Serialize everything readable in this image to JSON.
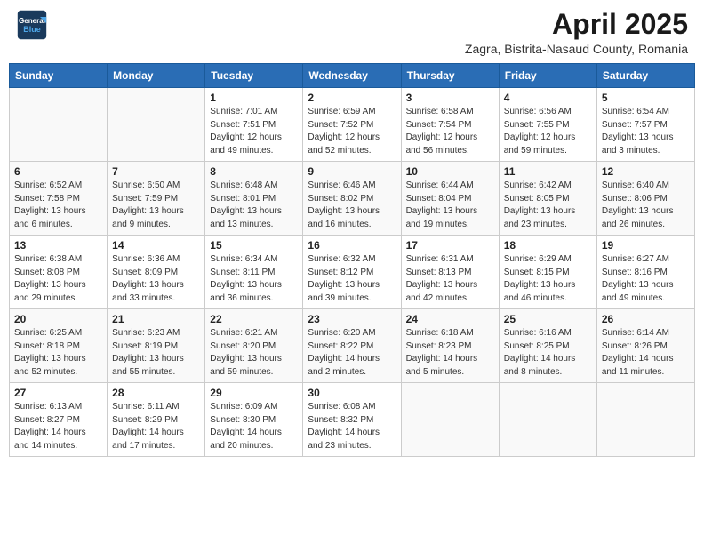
{
  "header": {
    "logo_line1": "General",
    "logo_line2": "Blue",
    "month_title": "April 2025",
    "subtitle": "Zagra, Bistrita-Nasaud County, Romania"
  },
  "columns": [
    "Sunday",
    "Monday",
    "Tuesday",
    "Wednesday",
    "Thursday",
    "Friday",
    "Saturday"
  ],
  "weeks": [
    [
      {
        "day": "",
        "info": ""
      },
      {
        "day": "",
        "info": ""
      },
      {
        "day": "1",
        "info": "Sunrise: 7:01 AM\nSunset: 7:51 PM\nDaylight: 12 hours\nand 49 minutes."
      },
      {
        "day": "2",
        "info": "Sunrise: 6:59 AM\nSunset: 7:52 PM\nDaylight: 12 hours\nand 52 minutes."
      },
      {
        "day": "3",
        "info": "Sunrise: 6:58 AM\nSunset: 7:54 PM\nDaylight: 12 hours\nand 56 minutes."
      },
      {
        "day": "4",
        "info": "Sunrise: 6:56 AM\nSunset: 7:55 PM\nDaylight: 12 hours\nand 59 minutes."
      },
      {
        "day": "5",
        "info": "Sunrise: 6:54 AM\nSunset: 7:57 PM\nDaylight: 13 hours\nand 3 minutes."
      }
    ],
    [
      {
        "day": "6",
        "info": "Sunrise: 6:52 AM\nSunset: 7:58 PM\nDaylight: 13 hours\nand 6 minutes."
      },
      {
        "day": "7",
        "info": "Sunrise: 6:50 AM\nSunset: 7:59 PM\nDaylight: 13 hours\nand 9 minutes."
      },
      {
        "day": "8",
        "info": "Sunrise: 6:48 AM\nSunset: 8:01 PM\nDaylight: 13 hours\nand 13 minutes."
      },
      {
        "day": "9",
        "info": "Sunrise: 6:46 AM\nSunset: 8:02 PM\nDaylight: 13 hours\nand 16 minutes."
      },
      {
        "day": "10",
        "info": "Sunrise: 6:44 AM\nSunset: 8:04 PM\nDaylight: 13 hours\nand 19 minutes."
      },
      {
        "day": "11",
        "info": "Sunrise: 6:42 AM\nSunset: 8:05 PM\nDaylight: 13 hours\nand 23 minutes."
      },
      {
        "day": "12",
        "info": "Sunrise: 6:40 AM\nSunset: 8:06 PM\nDaylight: 13 hours\nand 26 minutes."
      }
    ],
    [
      {
        "day": "13",
        "info": "Sunrise: 6:38 AM\nSunset: 8:08 PM\nDaylight: 13 hours\nand 29 minutes."
      },
      {
        "day": "14",
        "info": "Sunrise: 6:36 AM\nSunset: 8:09 PM\nDaylight: 13 hours\nand 33 minutes."
      },
      {
        "day": "15",
        "info": "Sunrise: 6:34 AM\nSunset: 8:11 PM\nDaylight: 13 hours\nand 36 minutes."
      },
      {
        "day": "16",
        "info": "Sunrise: 6:32 AM\nSunset: 8:12 PM\nDaylight: 13 hours\nand 39 minutes."
      },
      {
        "day": "17",
        "info": "Sunrise: 6:31 AM\nSunset: 8:13 PM\nDaylight: 13 hours\nand 42 minutes."
      },
      {
        "day": "18",
        "info": "Sunrise: 6:29 AM\nSunset: 8:15 PM\nDaylight: 13 hours\nand 46 minutes."
      },
      {
        "day": "19",
        "info": "Sunrise: 6:27 AM\nSunset: 8:16 PM\nDaylight: 13 hours\nand 49 minutes."
      }
    ],
    [
      {
        "day": "20",
        "info": "Sunrise: 6:25 AM\nSunset: 8:18 PM\nDaylight: 13 hours\nand 52 minutes."
      },
      {
        "day": "21",
        "info": "Sunrise: 6:23 AM\nSunset: 8:19 PM\nDaylight: 13 hours\nand 55 minutes."
      },
      {
        "day": "22",
        "info": "Sunrise: 6:21 AM\nSunset: 8:20 PM\nDaylight: 13 hours\nand 59 minutes."
      },
      {
        "day": "23",
        "info": "Sunrise: 6:20 AM\nSunset: 8:22 PM\nDaylight: 14 hours\nand 2 minutes."
      },
      {
        "day": "24",
        "info": "Sunrise: 6:18 AM\nSunset: 8:23 PM\nDaylight: 14 hours\nand 5 minutes."
      },
      {
        "day": "25",
        "info": "Sunrise: 6:16 AM\nSunset: 8:25 PM\nDaylight: 14 hours\nand 8 minutes."
      },
      {
        "day": "26",
        "info": "Sunrise: 6:14 AM\nSunset: 8:26 PM\nDaylight: 14 hours\nand 11 minutes."
      }
    ],
    [
      {
        "day": "27",
        "info": "Sunrise: 6:13 AM\nSunset: 8:27 PM\nDaylight: 14 hours\nand 14 minutes."
      },
      {
        "day": "28",
        "info": "Sunrise: 6:11 AM\nSunset: 8:29 PM\nDaylight: 14 hours\nand 17 minutes."
      },
      {
        "day": "29",
        "info": "Sunrise: 6:09 AM\nSunset: 8:30 PM\nDaylight: 14 hours\nand 20 minutes."
      },
      {
        "day": "30",
        "info": "Sunrise: 6:08 AM\nSunset: 8:32 PM\nDaylight: 14 hours\nand 23 minutes."
      },
      {
        "day": "",
        "info": ""
      },
      {
        "day": "",
        "info": ""
      },
      {
        "day": "",
        "info": ""
      }
    ]
  ]
}
